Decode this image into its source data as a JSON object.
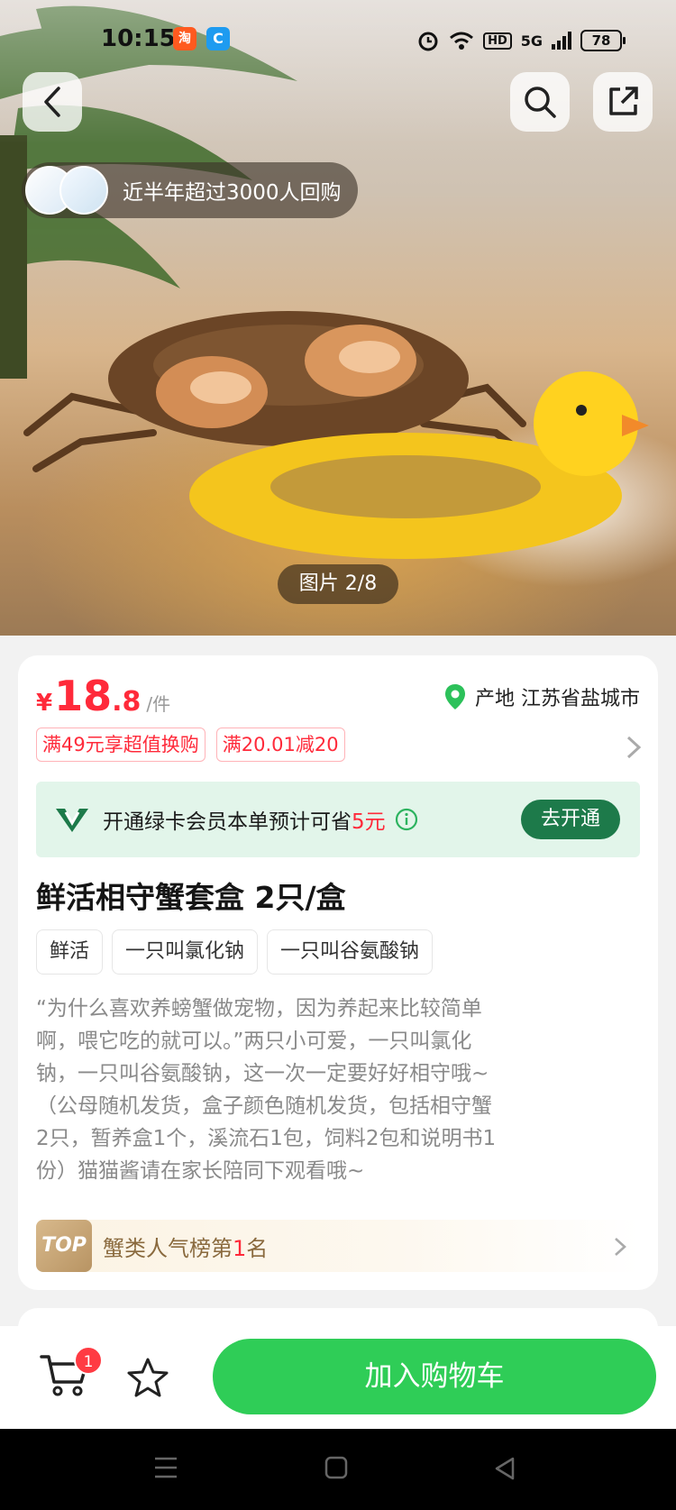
{
  "status_bar": {
    "time": "10:15",
    "app_badge_1": "淘",
    "app_badge_2": "C",
    "network": "HD",
    "signal": "5G",
    "battery": "78"
  },
  "hero": {
    "repurchase_text": "近半年超过3000人回购",
    "image_counter": "图片 2/8"
  },
  "product": {
    "currency": "¥",
    "price_int": "18",
    "price_dec": ".8",
    "price_unit": "/件",
    "origin_label": "产地 江苏省盐城市",
    "promos": [
      "满49元享超值换购",
      "满20.01减20"
    ],
    "member": {
      "text": "开通绿卡会员本单预计可省",
      "amount": "5元",
      "button": "去开通"
    },
    "title": "鲜活相守蟹套盒 2只/盒",
    "tags": [
      "鲜活",
      "一只叫氯化钠",
      "一只叫谷氨酸钠"
    ],
    "description_lines": [
      "“为什么喜欢养螃蟹做宠物，因为养起来比较简单",
      "啊，喂它吃的就可以。”两只小可爱，一只叫氯化",
      "钠，一只叫谷氨酸钠，这一次一定要好好相守哦~",
      "（公母随机发货，盒子颜色随机发货，包括相守蟹",
      "2只，暂养盒1个，溪流石1包，饲料2包和说明书1",
      "份）猫猫酱请在家长陪同下观看哦~"
    ],
    "rank": {
      "badge": "TOP",
      "prefix": "蟹类人气榜第",
      "number": "1",
      "suffix": "名"
    }
  },
  "bottom_bar": {
    "cart_count": "1",
    "add_to_cart": "加入购物车"
  },
  "colors": {
    "price_red": "#ff2a3a",
    "brand_green": "#2fcd57",
    "member_green": "#1d7a4a"
  }
}
